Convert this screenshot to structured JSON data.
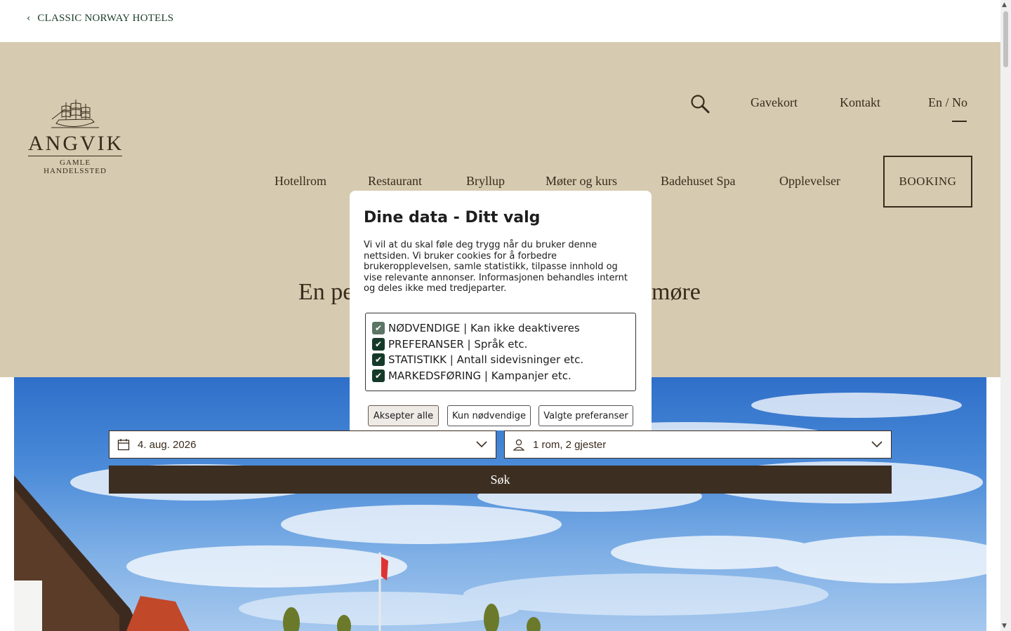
{
  "topbar": {
    "back_label": "CLASSIC NORWAY HOTELS"
  },
  "logo": {
    "name": "ANGVIK",
    "subtitle": "GAMLE HANDELSSTED"
  },
  "utility_nav": {
    "gift_card": "Gavekort",
    "contact": "Kontakt",
    "language": "En / No"
  },
  "main_nav": {
    "items": [
      "Hotellrom",
      "Restaurant",
      "Bryllup",
      "Møter og kurs",
      "Badehuset Spa",
      "Opplevelser"
    ],
    "booking": "BOOKING"
  },
  "tagline": {
    "left_visible": "En pe",
    "right_visible": "møre"
  },
  "booking_form": {
    "date_value": "4. aug. 2026",
    "guests_value": "1 rom, 2 gjester",
    "search_label": "Søk"
  },
  "cookie_modal": {
    "title": "Dine data - Ditt valg",
    "body": "Vi vil at du skal føle deg trygg når du bruker denne nettsiden. Vi bruker cookies for å forbedre brukeropplevelsen, samle statistikk, tilpasse innhold og vise relevante annonser. Informasjonen behandles internt og deles ikke med tredjeparter.",
    "preferences": [
      {
        "label": "NØDVENDIGE | Kan ikke deaktiveres",
        "checked": true,
        "disabled": true
      },
      {
        "label": "PREFERANSER | Språk etc.",
        "checked": true,
        "disabled": false
      },
      {
        "label": "STATISTIKK | Antall sidevisninger etc.",
        "checked": true,
        "disabled": false
      },
      {
        "label": "MARKEDSFØRING | Kampanjer etc.",
        "checked": true,
        "disabled": false
      }
    ],
    "buttons": {
      "accept_all": "Aksepter alle",
      "only_necessary": "Kun nødvendige",
      "selected_prefs": "Valgte preferanser"
    }
  },
  "colors": {
    "header_bg": "#d6cbb0",
    "text_brown": "#3a2a1c",
    "search_button": "#3d2e22",
    "checkbox": "#163a2a",
    "back_link": "#1d3d2a"
  },
  "icons": [
    "chevron-left-icon",
    "ship-icon",
    "search-icon",
    "calendar-icon",
    "person-icon",
    "chevron-down-icon",
    "check-icon"
  ]
}
